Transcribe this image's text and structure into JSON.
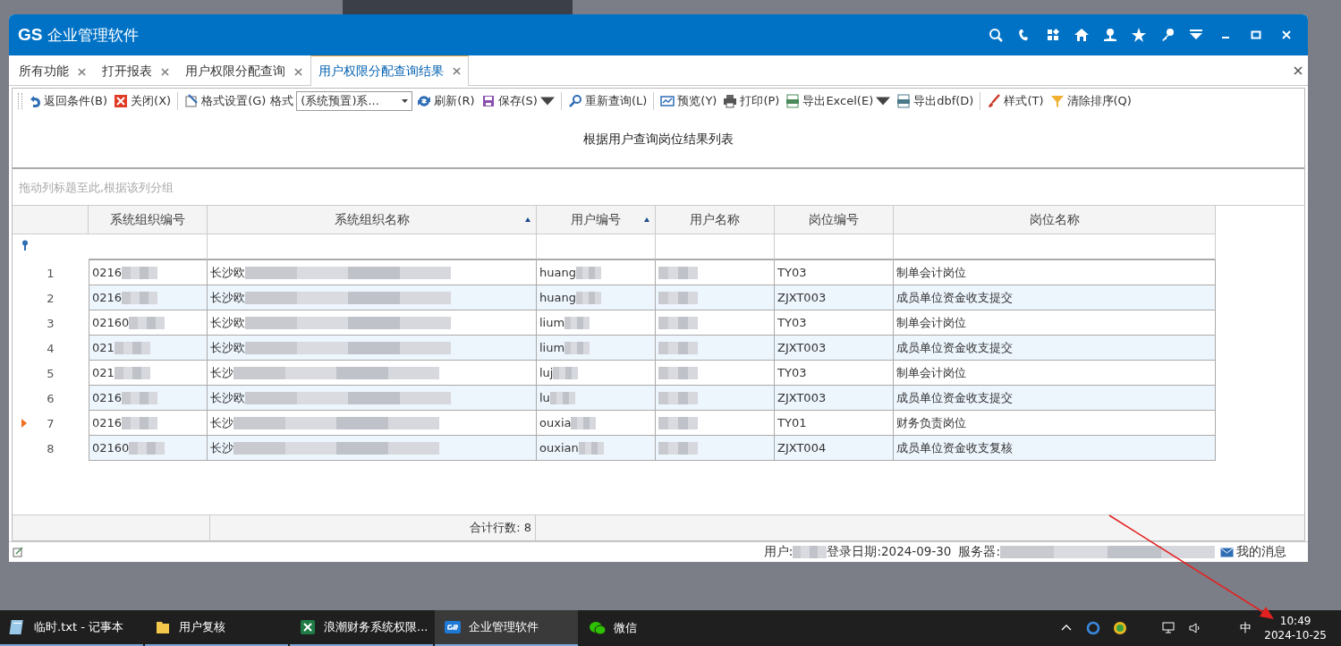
{
  "window": {
    "logo": "GS",
    "title": "企业管理软件"
  },
  "tabs": [
    {
      "label": "所有功能",
      "selected": false
    },
    {
      "label": "打开报表",
      "selected": false
    },
    {
      "label": "用户权限分配查询",
      "selected": false
    },
    {
      "label": "用户权限分配查询结果",
      "selected": true
    }
  ],
  "toolbar": [
    {
      "kind": "button",
      "label": "返回条件(B)"
    },
    {
      "kind": "button",
      "label": "关闭(X)"
    },
    {
      "kind": "separator"
    },
    {
      "kind": "button",
      "label": "格式设置(G)"
    },
    {
      "kind": "label",
      "label": "格式"
    },
    {
      "kind": "select",
      "label": "(系统预置)系..."
    },
    {
      "kind": "button",
      "label": "刷新(R)"
    },
    {
      "kind": "split",
      "label": "保存(S)"
    },
    {
      "kind": "separator"
    },
    {
      "kind": "button",
      "label": "重新查询(L)"
    },
    {
      "kind": "separator"
    },
    {
      "kind": "button",
      "label": "预览(Y)"
    },
    {
      "kind": "button",
      "label": "打印(P)"
    },
    {
      "kind": "split",
      "label": "导出Excel(E)"
    },
    {
      "kind": "button",
      "label": "导出dbf(D)"
    },
    {
      "kind": "separator"
    },
    {
      "kind": "button",
      "label": "样式(T)"
    },
    {
      "kind": "button",
      "label": "清除排序(Q)"
    }
  ],
  "report_title": "根据用户查询岗位结果列表",
  "group_panel": {
    "placeholder": "拖动列标题至此,根据该列分组"
  },
  "table": {
    "columns": [
      {
        "label": "系统组织编号",
        "sorted": false
      },
      {
        "label": "系统组织名称",
        "sorted": true
      },
      {
        "label": "用户编号",
        "sorted": true
      },
      {
        "label": "用户名称",
        "sorted": false
      },
      {
        "label": "岗位编号",
        "sorted": false
      },
      {
        "label": "岗位名称",
        "sorted": false
      }
    ],
    "rows": [
      {
        "number": "1",
        "current": false,
        "cells": [
          "0216",
          "长沙欧",
          "huang",
          "",
          "TY03",
          "制单会计岗位"
        ]
      },
      {
        "number": "2",
        "current": false,
        "cells": [
          "0216",
          "长沙欧",
          "huang",
          "",
          "ZJXT003",
          "成员单位资金收支提交"
        ]
      },
      {
        "number": "3",
        "current": false,
        "cells": [
          "02160",
          "长沙欧",
          "lium",
          "",
          "TY03",
          "制单会计岗位"
        ]
      },
      {
        "number": "4",
        "current": false,
        "cells": [
          "021",
          "长沙欧",
          "lium",
          "",
          "ZJXT003",
          "成员单位资金收支提交"
        ]
      },
      {
        "number": "5",
        "current": false,
        "cells": [
          "021",
          "长沙",
          "luj",
          "",
          "TY03",
          "制单会计岗位"
        ]
      },
      {
        "number": "6",
        "current": false,
        "cells": [
          "0216",
          "长沙欧",
          "lu",
          "",
          "ZJXT003",
          "成员单位资金收支提交"
        ]
      },
      {
        "number": "7",
        "current": true,
        "cells": [
          "0216",
          "长沙",
          "ouxia",
          "",
          "TY01",
          "财务负责岗位"
        ]
      },
      {
        "number": "8",
        "current": false,
        "cells": [
          "02160",
          "长沙",
          "ouxian",
          "",
          "ZJXT004",
          "成员单位资金收支复核"
        ]
      }
    ],
    "footer": {
      "row_count": "合计行数: 8"
    }
  },
  "status_bar": {
    "user": "用户:",
    "login_date": "登录日期:2024-09-30",
    "server": "服务器:",
    "messages": "我的消息"
  },
  "taskbar": {
    "apps": [
      {
        "label": "临时.txt - 记事本",
        "selected": false
      },
      {
        "label": "用户复核",
        "selected": false
      },
      {
        "label": "浪潮财务系统权限...",
        "selected": false
      },
      {
        "label": "企业管理软件",
        "selected": true
      },
      {
        "label": "微信",
        "selected": false
      }
    ],
    "input_method": "中",
    "time": "10:49",
    "date": "2024-10-25"
  }
}
